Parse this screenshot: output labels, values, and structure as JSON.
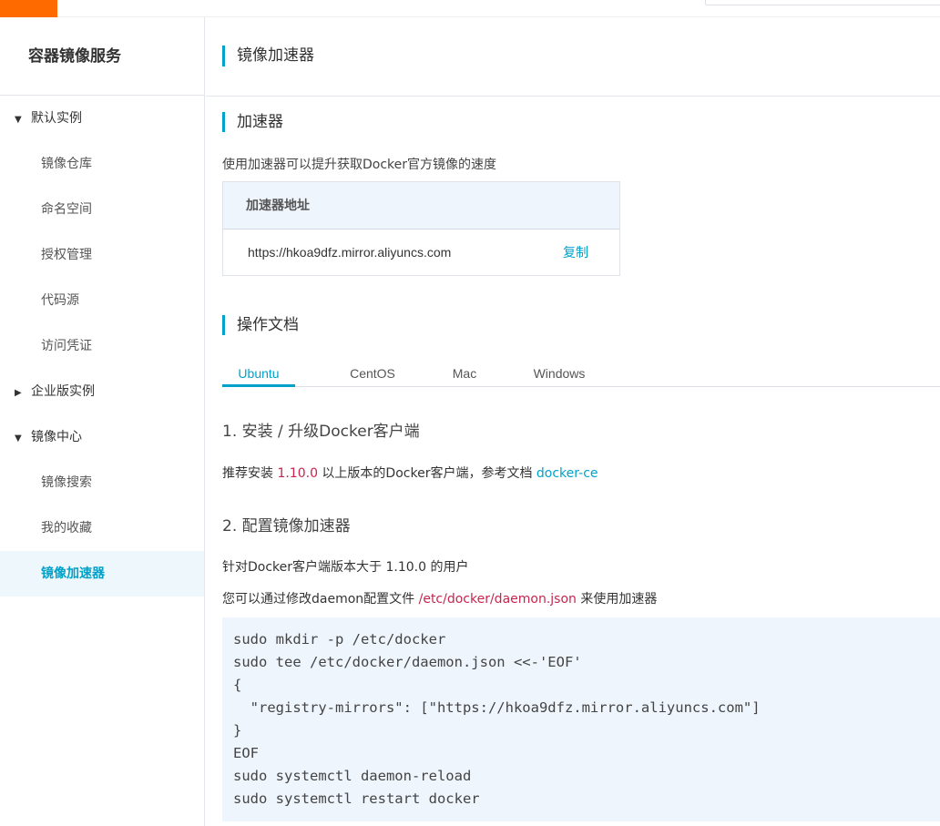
{
  "sidebar": {
    "title": "容器镜像服务",
    "groups": [
      {
        "label": "默认实例",
        "expanded": true,
        "items": [
          "镜像仓库",
          "命名空间",
          "授权管理",
          "代码源",
          "访问凭证"
        ]
      },
      {
        "label": "企业版实例",
        "expanded": false
      },
      {
        "label": "镜像中心",
        "expanded": true,
        "items": [
          "镜像搜索",
          "我的收藏",
          "镜像加速器"
        ]
      }
    ],
    "active_item": "镜像加速器"
  },
  "page": {
    "title": "镜像加速器"
  },
  "accelerator": {
    "section_title": "加速器",
    "description": "使用加速器可以提升获取Docker官方镜像的速度",
    "table_header": "加速器地址",
    "address": "https://hkoa9dfz.mirror.aliyuncs.com",
    "copy_label": "复制"
  },
  "docs": {
    "section_title": "操作文档",
    "tabs": [
      "Ubuntu",
      "CentOS",
      "Mac",
      "Windows"
    ],
    "active_tab": "Ubuntu",
    "step1_title": "1. 安装 / 升级Docker客户端",
    "step1_text_before": "推荐安装 ",
    "step1_version": "1.10.0",
    "step1_text_after": " 以上版本的Docker客户端，参考文档 ",
    "step1_link": "docker-ce",
    "step2_title": "2. 配置镜像加速器",
    "step2_text1": "针对Docker客户端版本大于 1.10.0 的用户",
    "step2_text2_before": "您可以通过修改daemon配置文件 ",
    "step2_path": "/etc/docker/daemon.json",
    "step2_text2_after": " 来使用加速器",
    "code": "sudo mkdir -p /etc/docker\nsudo tee /etc/docker/daemon.json <<-'EOF'\n{\n  \"registry-mirrors\": [\"https://hkoa9dfz.mirror.aliyuncs.com\"]\n}\nEOF\nsudo systemctl daemon-reload\nsudo systemctl restart docker"
  },
  "colors": {
    "accent": "#00a2ca",
    "brand": "#ff6a00",
    "code_red": "#c7254e"
  }
}
